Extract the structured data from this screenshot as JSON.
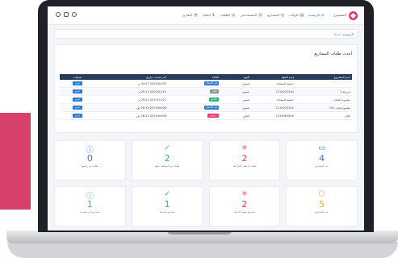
{
  "topbar": {
    "brand": "المستودع",
    "nav": [
      {
        "label": "الرئيسية",
        "active": true,
        "icon": "home-icon"
      },
      {
        "label": "الرفات",
        "active": false,
        "icon": "archive-icon"
      },
      {
        "label": "المشاريع",
        "active": false,
        "icon": "projects-icon"
      },
      {
        "label": "المستخدمين",
        "active": false,
        "icon": "users-icon"
      },
      {
        "label": "الطلبات",
        "active": false,
        "icon": "requests-icon"
      },
      {
        "label": "المالية",
        "active": false,
        "icon": "finance-icon"
      },
      {
        "label": "التقارير",
        "active": false,
        "icon": "reports-icon"
      }
    ]
  },
  "breadcrumb": {
    "home": "الرئيسية",
    "current": "عداد"
  },
  "panel": {
    "title": "أحدث طلبات المشاريع",
    "table": {
      "headers": [
        "اسم المشروع",
        "إسم الجهة",
        "النوع",
        "الحالة",
        "آخر تحديث بتاريخ",
        "عمليات"
      ],
      "rows": [
        {
          "project": "",
          "entity": "جمعية السعادة",
          "type": "تنموي",
          "status": "قيد الانتظار",
          "status_color": "#2d79d7",
          "date": "2020/02/03 04:57 م",
          "action": "عرض"
        },
        {
          "project": "مزرعة 1",
          "entity": "1115223344",
          "type": "تنموي",
          "status": "ملغي",
          "status_color": "#8a9099",
          "date": "2020/01/15 09:15 م",
          "action": "عرض"
        },
        {
          "project": "مشروع الشاي",
          "entity": "جمعية السعادة",
          "type": "تنموي",
          "status": "مكتمل",
          "status_color": "#2bb673",
          "date": "2019/11/21 09:24 م",
          "action": "عرض"
        },
        {
          "project": "مشروع بحث 101",
          "entity": "1115223341",
          "type": "تنموي",
          "status": "قيد الانتظار",
          "status_color": "#2d79d7",
          "date": "2019/09/08 09:15 ص",
          "action": "عرض"
        },
        {
          "project": "علاج",
          "entity": "1234567890",
          "type": "إغاثي",
          "status": "مرفوض",
          "status_color": "#e8356f",
          "date": "2019/09/08 08:12 ص",
          "action": "عرض"
        }
      ]
    }
  },
  "cards": [
    {
      "value": "4",
      "label": "عدد المشاريع",
      "icon": "monitor-icon",
      "color": "#2d79d7"
    },
    {
      "value": "2",
      "label": "طلبات بانتظار المراجعة",
      "icon": "loader-icon",
      "color": "#e8356f"
    },
    {
      "value": "2",
      "label": "طلبات تم الموافقة عليها",
      "icon": "check-icon",
      "color": "#2bb673"
    },
    {
      "value": "0",
      "label": "طلبات تم رفضها",
      "icon": "alert-icon",
      "color": "#2d79d7"
    },
    {
      "value": "5",
      "label": "عدد المشاريع",
      "icon": "cube-icon",
      "color": "#f0a93e"
    },
    {
      "value": "2",
      "label": "مشاريع تنتظر الاعتماد",
      "icon": "loader-icon",
      "color": "#e8356f"
    },
    {
      "value": "1",
      "label": "مشاريع معتمدة",
      "icon": "check-icon",
      "color": "#2bb673"
    },
    {
      "value": "1",
      "label": "مشاريع غير معتمدة",
      "icon": "alert-icon",
      "color": "#2bb673"
    }
  ]
}
